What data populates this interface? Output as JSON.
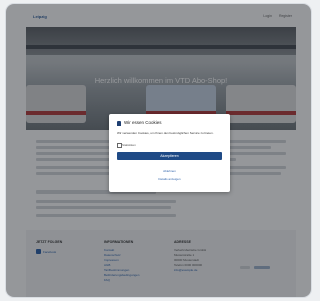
{
  "header": {
    "logo_text": "Leipzig",
    "nav": [
      "Login",
      "Register"
    ]
  },
  "hero": {
    "title": "Herzlich willkommen im VTD Abo-Shop!"
  },
  "footer": {
    "col1": {
      "title": "JETZT FOLGEN",
      "link": "Facebook"
    },
    "col2": {
      "title": "INFORMATIONEN",
      "links": [
        "Kontakt",
        "Datenschutz",
        "Impressum",
        "AGB",
        "Tarifbestimmungen",
        "Beförderungsbedingungen",
        "FAQ"
      ]
    },
    "col3": {
      "title": "ADRESSE",
      "lines": [
        "Verkehrsbetriebe GmbH",
        "Musterstraße 1",
        "00000 Musterstadt",
        "Telefon 0000 000000",
        "info@example.de"
      ]
    }
  },
  "cookie_dialog": {
    "title": "Wir essen Cookies",
    "text": "Wir verwenden Cookies, um Ihnen den bestmöglichen Service zu bieten.",
    "checkbox_label": "Statistiken",
    "accept_label": "Akzeptieren",
    "deny_label": "Ablehnen",
    "settings_label": "Details anzeigen"
  },
  "colors": {
    "accent": "#1f4a86",
    "link": "#2a5fa8"
  }
}
